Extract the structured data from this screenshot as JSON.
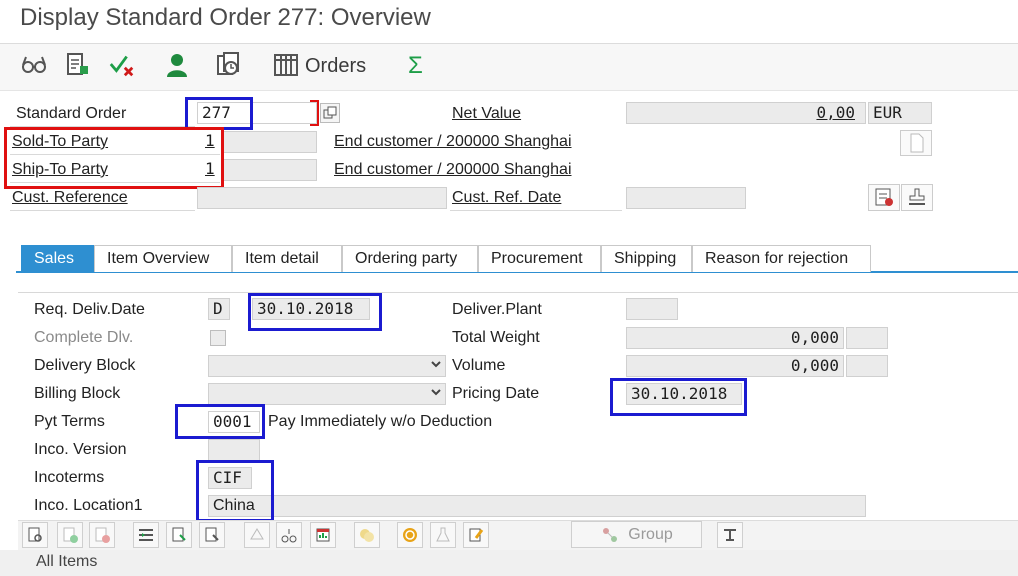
{
  "window": {
    "title": "Display Standard Order 277: Overview"
  },
  "toolbar": {
    "items": [
      {
        "icon": "glasses-icon"
      },
      {
        "icon": "document-edit-icon"
      },
      {
        "icon": "check-cross-icon"
      },
      {
        "icon": "person-icon"
      },
      {
        "icon": "copy-document-icon"
      }
    ],
    "orders_label": "Orders",
    "sum_symbol": "Σ"
  },
  "header": {
    "standard_order_label": "Standard Order",
    "standard_order_value": "277",
    "net_value_label": "Net Value",
    "net_value": "0,00",
    "currency": "EUR",
    "sold_to_label": "Sold-To Party",
    "sold_to_value": "1",
    "sold_to_desc": "End customer / 200000 Shanghai",
    "ship_to_label": "Ship-To Party",
    "ship_to_value": "1",
    "ship_to_desc": "End customer / 200000 Shanghai",
    "cust_ref_label": "Cust. Reference",
    "cust_ref_date_label": "Cust. Ref. Date"
  },
  "tabs": [
    {
      "label": "Sales",
      "active": true
    },
    {
      "label": "Item Overview"
    },
    {
      "label": "Item detail"
    },
    {
      "label": "Ordering party"
    },
    {
      "label": "Procurement"
    },
    {
      "label": "Shipping"
    },
    {
      "label": "Reason for rejection"
    }
  ],
  "sales": {
    "req_deliv_label": "Req. Deliv.Date",
    "req_deliv_format": "D",
    "req_deliv_date": "30.10.2018",
    "complete_dlv_label": "Complete Dlv.",
    "delivery_block_label": "Delivery Block",
    "billing_block_label": "Billing Block",
    "pyt_terms_label": "Pyt Terms",
    "pyt_terms_value": "0001",
    "pyt_terms_desc": "Pay Immediately w/o Deduction",
    "inco_version_label": "Inco. Version",
    "incoterms_label": "Incoterms",
    "incoterms_value": "CIF",
    "inco_location_label": "Inco. Location1",
    "inco_location_value": "China",
    "deliver_plant_label": "Deliver.Plant",
    "total_weight_label": "Total Weight",
    "total_weight_value": "0,000",
    "volume_label": "Volume",
    "volume_value": "0,000",
    "pricing_date_label": "Pricing Date",
    "pricing_date_value": "30.10.2018"
  },
  "bottom_toolbar": {
    "group_label": "Group"
  },
  "footer": {
    "all_items_label": "All Items"
  },
  "colors": {
    "highlight_blue": "#1b1bd0",
    "highlight_red": "#e01010",
    "tab_active": "#2e8fd1"
  }
}
